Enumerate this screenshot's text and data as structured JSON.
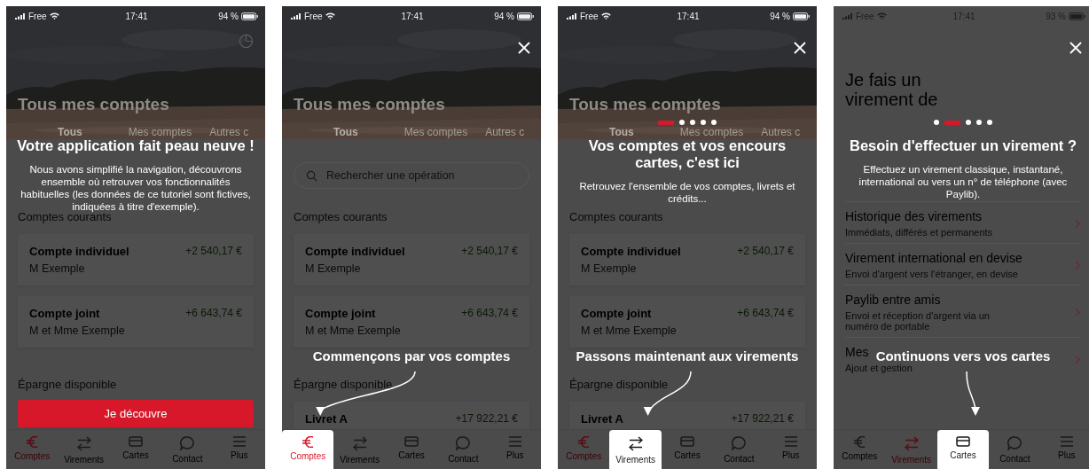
{
  "screens": [
    {
      "kind": "accounts",
      "status": {
        "carrier": "Free",
        "time": "17:41",
        "battery": "94 %",
        "dark": false
      },
      "header": {
        "title": "Tous mes comptes",
        "tabs": [
          {
            "label": "Tous",
            "selected": true
          },
          {
            "label": "Mes comptes",
            "selected": false
          },
          {
            "label": "Autres c",
            "selected": false
          }
        ]
      },
      "sections": [
        {
          "title": "Comptes courants",
          "accounts": [
            {
              "name": "Compte individuel",
              "holder": "M Exemple",
              "balance": "+2 540,17 €"
            },
            {
              "name": "Compte joint",
              "holder": "M et Mme Exemple",
              "balance": "+6 643,74 €"
            }
          ]
        },
        {
          "title": "Épargne disponible"
        }
      ],
      "nav": [
        {
          "label": "Comptes",
          "selected": true,
          "highlighted": false
        },
        {
          "label": "Virements",
          "selected": false,
          "highlighted": false
        },
        {
          "label": "Cartes",
          "selected": false,
          "highlighted": false
        },
        {
          "label": "Contact",
          "selected": false,
          "highlighted": false
        },
        {
          "label": "Plus",
          "selected": false,
          "highlighted": false
        }
      ],
      "overlay": {
        "title": "Votre application fait peau neuve !",
        "body": "Nous avons simplifié la navigation, découvrons ensemble où retrouver vos fonctionnalités habituelles (les données de ce tutoriel sont fictives, indiquées à titre d'exemple).",
        "button": "Je découvre"
      }
    },
    {
      "kind": "accounts",
      "status": {
        "carrier": "Free",
        "time": "17:41",
        "battery": "94 %",
        "dark": false
      },
      "header": {
        "title": "Tous mes comptes",
        "tabs": [
          {
            "label": "Tous",
            "selected": true
          },
          {
            "label": "Mes comptes",
            "selected": false
          },
          {
            "label": "Autres c",
            "selected": false
          }
        ]
      },
      "search": {
        "placeholder": "Rechercher une opération"
      },
      "sections": [
        {
          "title": "Comptes courants",
          "accounts": [
            {
              "name": "Compte individuel",
              "holder": "M Exemple",
              "balance": "+2 540,17 €"
            },
            {
              "name": "Compte joint",
              "holder": "M et Mme Exemple",
              "balance": "+6 643,74 €"
            }
          ]
        },
        {
          "title": "Épargne disponible",
          "accounts": [
            {
              "name": "Livret A",
              "balance": "+17 922,21 €"
            }
          ]
        }
      ],
      "nav": [
        {
          "label": "Comptes",
          "selected": true,
          "highlighted": true
        },
        {
          "label": "Virements",
          "selected": false,
          "highlighted": false
        },
        {
          "label": "Cartes",
          "selected": false,
          "highlighted": false
        },
        {
          "label": "Contact",
          "selected": false,
          "highlighted": false
        },
        {
          "label": "Plus",
          "selected": false,
          "highlighted": false
        }
      ],
      "overlay": {
        "close": true,
        "hint": "Commençons par vos comptes"
      }
    },
    {
      "kind": "accounts",
      "status": {
        "carrier": "Free",
        "time": "17:41",
        "battery": "94 %",
        "dark": false
      },
      "header": {
        "title": "Tous mes comptes",
        "tabs": [
          {
            "label": "Tous",
            "selected": true
          },
          {
            "label": "Mes comptes",
            "selected": false
          },
          {
            "label": "Autres c",
            "selected": false
          }
        ]
      },
      "sections": [
        {
          "title": "Comptes courants",
          "accounts": [
            {
              "name": "Compte individuel",
              "holder": "M Exemple",
              "balance": "+2 540,17 €"
            },
            {
              "name": "Compte joint",
              "holder": "M et Mme Exemple",
              "balance": "+6 643,74 €"
            }
          ]
        },
        {
          "title": "Épargne disponible",
          "accounts": [
            {
              "name": "Livret A",
              "balance": "+17 922,21 €"
            }
          ]
        }
      ],
      "nav": [
        {
          "label": "Comptes",
          "selected": true,
          "highlighted": false
        },
        {
          "label": "Virements",
          "selected": false,
          "highlighted": true
        },
        {
          "label": "Cartes",
          "selected": false,
          "highlighted": false
        },
        {
          "label": "Contact",
          "selected": false,
          "highlighted": false
        },
        {
          "label": "Plus",
          "selected": false,
          "highlighted": false
        }
      ],
      "overlay": {
        "close": true,
        "steps": [
          {
            "selected": true
          },
          {
            "selected": false
          },
          {
            "selected": false
          },
          {
            "selected": false
          },
          {
            "selected": false
          }
        ],
        "title": "Vos comptes et vos encours cartes, c'est ici",
        "body": "Retrouvez l'ensemble de vos comptes, livrets et crédits...",
        "hint": "Passons maintenant aux virements"
      }
    },
    {
      "kind": "transfer",
      "status": {
        "carrier": "Free",
        "time": "17:41",
        "battery": "93 %",
        "dark": true
      },
      "heading": [
        "Je fais un",
        "virement de"
      ],
      "menu": [
        {
          "title": "Historique des virements",
          "subtitle": "Immédiats, différés et permanents"
        },
        {
          "title": "Virement international en devise",
          "subtitle": "Envoi d'argent vers l'étranger, en devise"
        },
        {
          "title": "Paylib entre amis",
          "subtitle": "Envoi et réception d'argent via un numéro de portable"
        },
        {
          "title": "Mes",
          "subtitle": "Ajout et gestion"
        }
      ],
      "nav": [
        {
          "label": "Comptes",
          "selected": false,
          "highlighted": false
        },
        {
          "label": "Virements",
          "selected": true,
          "highlighted": false
        },
        {
          "label": "Cartes",
          "selected": false,
          "highlighted": true
        },
        {
          "label": "Contact",
          "selected": false,
          "highlighted": false
        },
        {
          "label": "Plus",
          "selected": false,
          "highlighted": false
        }
      ],
      "overlay": {
        "close": true,
        "steps": [
          {
            "selected": false
          },
          {
            "selected": true
          },
          {
            "selected": false
          },
          {
            "selected": false
          },
          {
            "selected": false
          }
        ],
        "title": "Besoin d'effectuer un virement ?",
        "body": "Effectuez un virement classique, instantané, international ou vers un n° de téléphone (avec Paylib).",
        "hint": "Continuons vers vos cartes"
      }
    }
  ]
}
